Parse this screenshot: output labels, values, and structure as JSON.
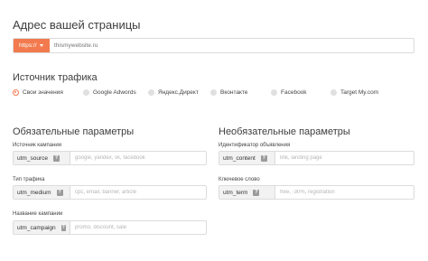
{
  "page_address": {
    "title": "Адрес вашей страницы",
    "protocol": "https://",
    "url_placeholder": "thismywebsite.ru"
  },
  "traffic_source": {
    "title": "Источник трафика",
    "options": [
      {
        "label": "Свои значения",
        "checked": true
      },
      {
        "label": "Google Adwords",
        "checked": false
      },
      {
        "label": "Яндекс.Директ",
        "checked": false
      },
      {
        "label": "Вконтакте",
        "checked": false
      },
      {
        "label": "Facebook",
        "checked": false
      },
      {
        "label": "Target My.com",
        "checked": false
      }
    ]
  },
  "required": {
    "title": "Обязательные параметры",
    "fields": [
      {
        "label": "Источник кампании",
        "tag": "utm_source",
        "placeholder": "google, yandex, vk, facebook"
      },
      {
        "label": "Тип трафика",
        "tag": "utm_medium",
        "placeholder": "cpc, email, banner, article"
      },
      {
        "label": "Название кампании",
        "tag": "utm_campaign",
        "placeholder": "promo, discount, sale"
      }
    ]
  },
  "optional": {
    "title": "Необязательные параметры",
    "fields": [
      {
        "label": "Идентификатор объявления",
        "tag": "utm_content",
        "placeholder": "link, landing page"
      },
      {
        "label": "Ключевое слово",
        "tag": "utm_term",
        "placeholder": "free, -30%, registration"
      }
    ]
  },
  "help_glyph": "?",
  "colors": {
    "accent": "#f27a4e",
    "tag_bg": "#f2f2f2",
    "help_bg": "#9b9b9b"
  }
}
